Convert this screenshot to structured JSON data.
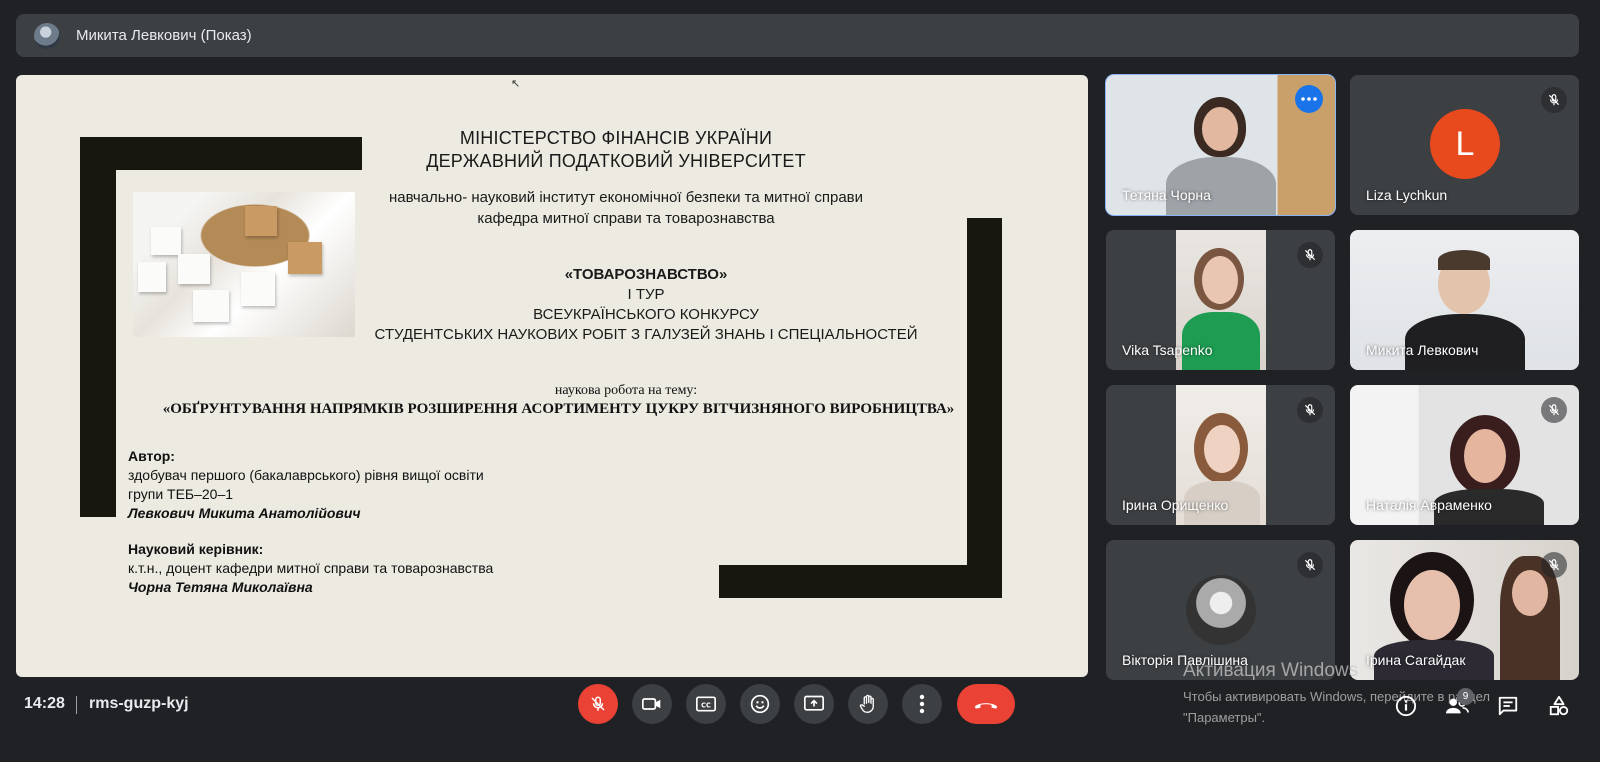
{
  "presenter": {
    "name": "Микита Левкович (Показ)"
  },
  "slide": {
    "ministry_line1": "МІНІСТЕРСТВО ФІНАНСІВ УКРАЇНИ",
    "ministry_line2": "ДЕРЖАВНИЙ ПОДАТКОВИЙ УНІВЕРСИТЕТ",
    "institute_line1": "навчально- науковий інститут економічної безпеки та митної справи",
    "institute_line2": "кафедра митної справи та товарознавства",
    "contest_line1": "«ТОВАРОЗНАВСТВО»",
    "contest_line2": "І ТУР",
    "contest_line3": "ВСЕУКРАЇНСЬКОГО КОНКУРСУ",
    "contest_line4": "СТУДЕНТСЬКИХ НАУКОВИХ РОБІТ З ГАЛУЗЕЙ ЗНАНЬ І СПЕЦІАЛЬНОСТЕЙ",
    "topic_label": "наукова робота на тему:",
    "topic": "«ОБҐРУНТУВАННЯ НАПРЯМКІВ РОЗШИРЕННЯ АСОРТИМЕНТУ ЦУКРУ ВІТЧИЗНЯНОГО ВИРОБНИЦТВА»",
    "author_heading": "Автор:",
    "author_line1": "здобувач першого (бакалаврського) рівня вищої освіти",
    "author_line2": "групи ТЕБ–20–1",
    "author_name": "Левкович Микита Анатолійович",
    "advisor_heading": "Науковий керівник:",
    "advisor_line1": "к.т.н., доцент кафедри митної справи та товарознавства",
    "advisor_name": "Чорна Тетяна Миколаївна"
  },
  "participants": [
    {
      "name": "Тетяна Чорна"
    },
    {
      "name": "Liza Lychkun",
      "initial": "L"
    },
    {
      "name": "Vika Tsapenko"
    },
    {
      "name": "Микита Левкович"
    },
    {
      "name": "Ірина Орищенко"
    },
    {
      "name": "Наталія Авраменко"
    },
    {
      "name": "Вікторія Павлішина"
    },
    {
      "name": "Ірина Сагайдак"
    }
  ],
  "bottom": {
    "time": "14:28",
    "meeting_code": "rms-guzp-kyj",
    "people_count": "9"
  },
  "watermark": {
    "title": "Активация Windows",
    "line1": "Чтобы активировать Windows, перейдите в раздел",
    "line2": "\"Параметры\"."
  },
  "colors": {
    "accent": "#8ab4f8",
    "end_call": "#ea4335",
    "avatar_l": "#e8491d"
  }
}
